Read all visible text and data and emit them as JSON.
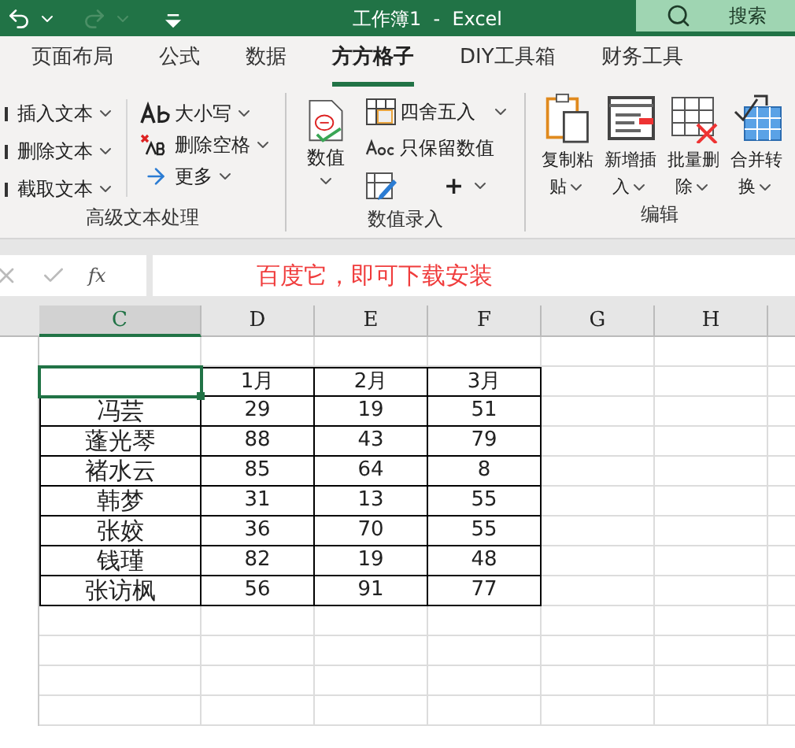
{
  "title_bar": {
    "title": "工作簿1  -  Excel",
    "search": "搜索"
  },
  "tabs": [
    {
      "label": "页面布局",
      "selected": false
    },
    {
      "label": "公式",
      "selected": false
    },
    {
      "label": "数据",
      "selected": false
    },
    {
      "label": "方方格子",
      "selected": true
    },
    {
      "label": "DIY工具箱",
      "selected": false
    },
    {
      "label": "财务工具",
      "selected": false
    }
  ],
  "text_group": {
    "label": "高级文本处理",
    "left_items": [
      "插入文本",
      "删除文本",
      "截取文本"
    ],
    "right_items": [
      {
        "kind": "case",
        "label": "大小写"
      },
      {
        "kind": "trim",
        "label": "删除空格"
      },
      {
        "kind": "more",
        "label": "更多"
      }
    ]
  },
  "number_group": {
    "label": "数值录入",
    "big_button": "数值",
    "items": [
      {
        "kind": "round",
        "label": "四舍五入"
      },
      {
        "kind": "keep",
        "label": "只保留数值"
      }
    ],
    "plus": "+"
  },
  "edit_group": {
    "label": "编辑",
    "buttons": [
      {
        "kind": "paste",
        "line1": "复制粘",
        "line2": "贴"
      },
      {
        "kind": "insert",
        "line1": "新增插",
        "line2": "入"
      },
      {
        "kind": "delete",
        "line1": "批量删",
        "line2": "除"
      },
      {
        "kind": "merge",
        "line1": "合并转",
        "line2": "换"
      }
    ]
  },
  "formula_bar": {
    "function_label": "fx",
    "value": "百度它，即可下载安装"
  },
  "columns": [
    {
      "label": "C",
      "selected": true
    },
    {
      "label": "D",
      "selected": false
    },
    {
      "label": "E",
      "selected": false
    },
    {
      "label": "F",
      "selected": false
    },
    {
      "label": "G",
      "selected": false
    },
    {
      "label": "H",
      "selected": false
    }
  ],
  "table": {
    "header": [
      "1月",
      "2月",
      "3月"
    ],
    "rows": [
      [
        "冯芸",
        "29",
        "19",
        "51"
      ],
      [
        "蓬光琴",
        "88",
        "43",
        "79"
      ],
      [
        "褚水云",
        "85",
        "64",
        "8"
      ],
      [
        "韩梦",
        "31",
        "13",
        "55"
      ],
      [
        "张姣",
        "36",
        "70",
        "55"
      ],
      [
        "钱瑾",
        "82",
        "19",
        "48"
      ],
      [
        "张访枫",
        "56",
        "91",
        "77"
      ]
    ]
  }
}
